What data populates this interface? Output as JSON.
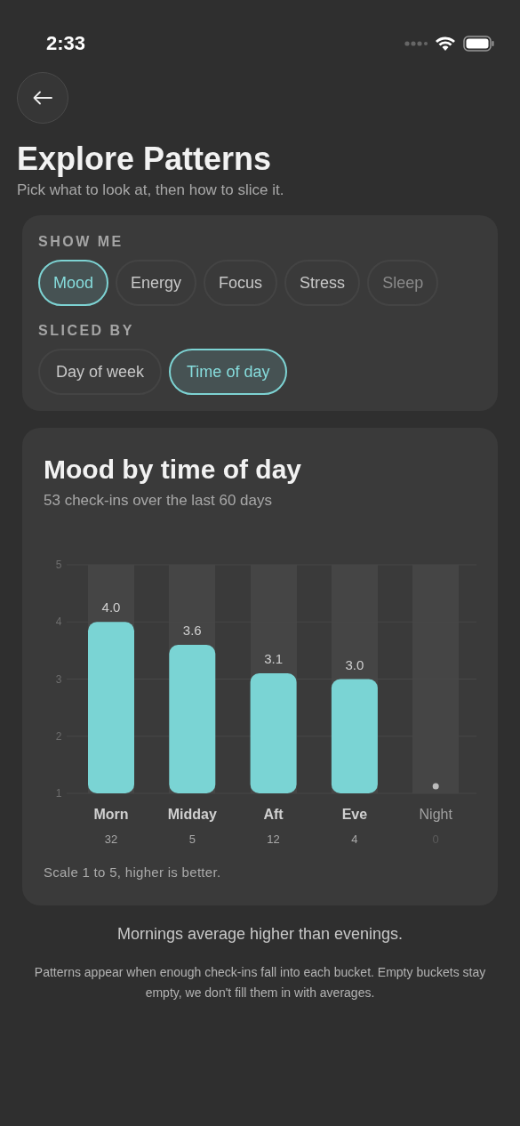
{
  "status_bar": {
    "time": "2:33"
  },
  "header": {
    "title": "Explore Patterns",
    "subtitle": "Pick what to look at, then how to slice it."
  },
  "filters": [
    {
      "label": "SHOW ME",
      "options": [
        {
          "label": "Mood",
          "selected": true
        },
        {
          "label": "Energy",
          "selected": false
        },
        {
          "label": "Focus",
          "selected": false
        },
        {
          "label": "Stress",
          "selected": false
        },
        {
          "label": "Sleep",
          "selected": false
        }
      ]
    },
    {
      "label": "SLICED BY",
      "options": [
        {
          "label": "Day of week",
          "selected": false
        },
        {
          "label": "Time of day",
          "selected": true
        }
      ]
    }
  ],
  "chart_card": {
    "title": "Mood by time of day",
    "subtitle": "53 check-ins over the last 60 days",
    "chart_data": {
      "type": "bar",
      "categories": [
        "Morn",
        "Midday",
        "Aft",
        "Eve",
        "Night"
      ],
      "values": [
        4.0,
        3.6,
        3.1,
        3.0,
        null
      ],
      "ylim": [
        1,
        5
      ],
      "yticks": [
        1,
        2,
        3,
        4,
        5
      ],
      "data_labels": true,
      "grid": true,
      "value_labels": [
        "4.0",
        "3.6",
        "3.1",
        "3.0",
        null
      ]
    },
    "counts": [
      "32",
      "5",
      "12",
      "4",
      "0"
    ],
    "footnote": "Scale 1 to 5, higher is better."
  },
  "insight": "Mornings average higher than evenings.",
  "note": "Patterns appear when enough check-ins fall into each bucket. Empty buckets stay empty, we don't fill them in with averages."
}
